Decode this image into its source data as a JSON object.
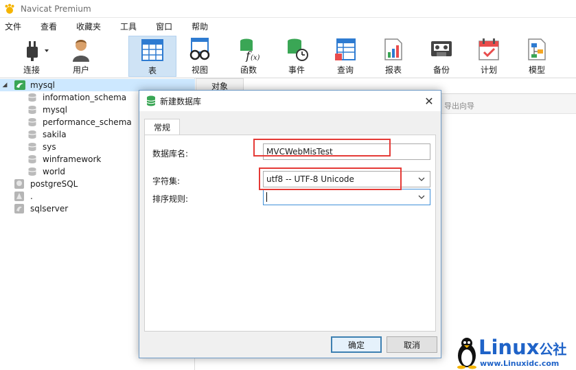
{
  "window": {
    "title": "Navicat Premium"
  },
  "menu": [
    "文件",
    "查看",
    "收藏夹",
    "工具",
    "窗口",
    "帮助"
  ],
  "toolbar": {
    "connect": "连接",
    "user": "用户",
    "table": "表",
    "view": "视图",
    "function": "函数",
    "event": "事件",
    "query": "查询",
    "report": "报表",
    "backup": "备份",
    "schedule": "计划",
    "model": "模型"
  },
  "tree": {
    "connection": "mysql",
    "databases": [
      "information_schema",
      "mysql",
      "performance_schema",
      "sakila",
      "sys",
      "winframework",
      "world"
    ],
    "other_connections": [
      "postgreSQL",
      ".",
      "sqlserver"
    ]
  },
  "right": {
    "tab": "对象",
    "export_wizard": "导出向导"
  },
  "dialog": {
    "title": "新建数据库",
    "tab": "常规",
    "db_name_label": "数据库名:",
    "db_name_value": "MVCWebMisTest",
    "charset_label": "字符集:",
    "charset_value": "utf8 -- UTF-8 Unicode",
    "collation_label": "排序规则:",
    "collation_value": "",
    "ok": "确定",
    "cancel": "取消"
  },
  "watermark": {
    "logo": "Linux",
    "suffix": "公社",
    "url": "www.Linuxidc.com"
  },
  "colors": {
    "highlight": "#e53935",
    "accent": "#3f8fd8",
    "selected": "#cde8ff",
    "brand": "#1f63c8"
  }
}
